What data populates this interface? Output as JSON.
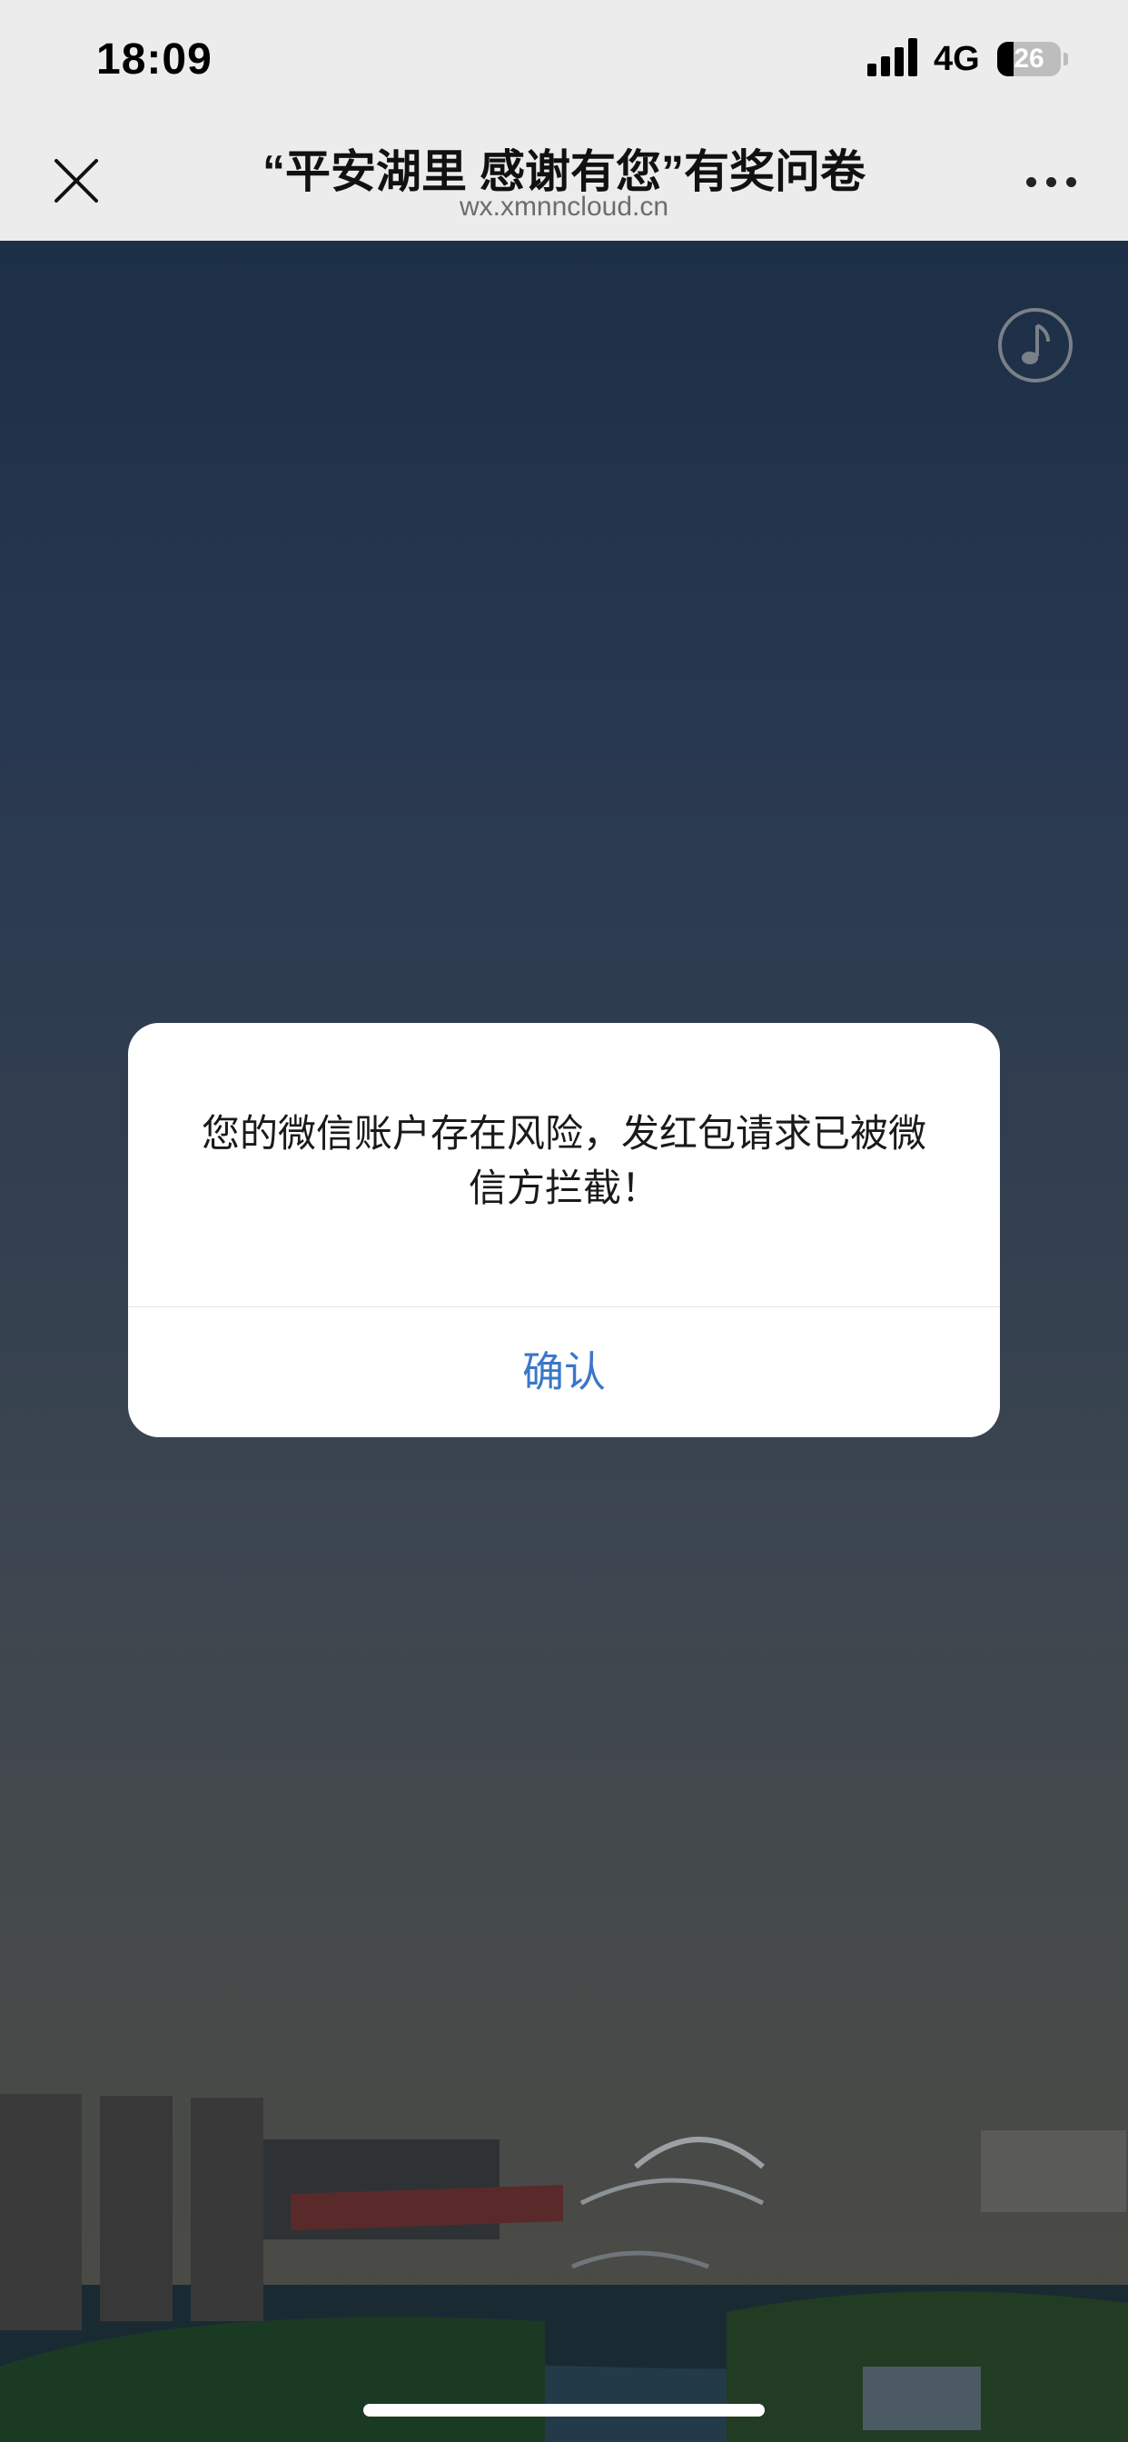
{
  "status_bar": {
    "time": "18:09",
    "network": "4G",
    "battery": "26"
  },
  "nav": {
    "title": "“平安湖里 感谢有您”有奖问卷",
    "url": "wx.xmnncloud.cn",
    "close_icon": "close-icon",
    "more_icon": "more-icon"
  },
  "page": {
    "music_icon": "music-note-icon"
  },
  "dialog": {
    "message": "您的微信账户存在风险，发红包请求已被微信方拦截！",
    "confirm_label": "确认",
    "confirm_color": "#3a77c9"
  }
}
